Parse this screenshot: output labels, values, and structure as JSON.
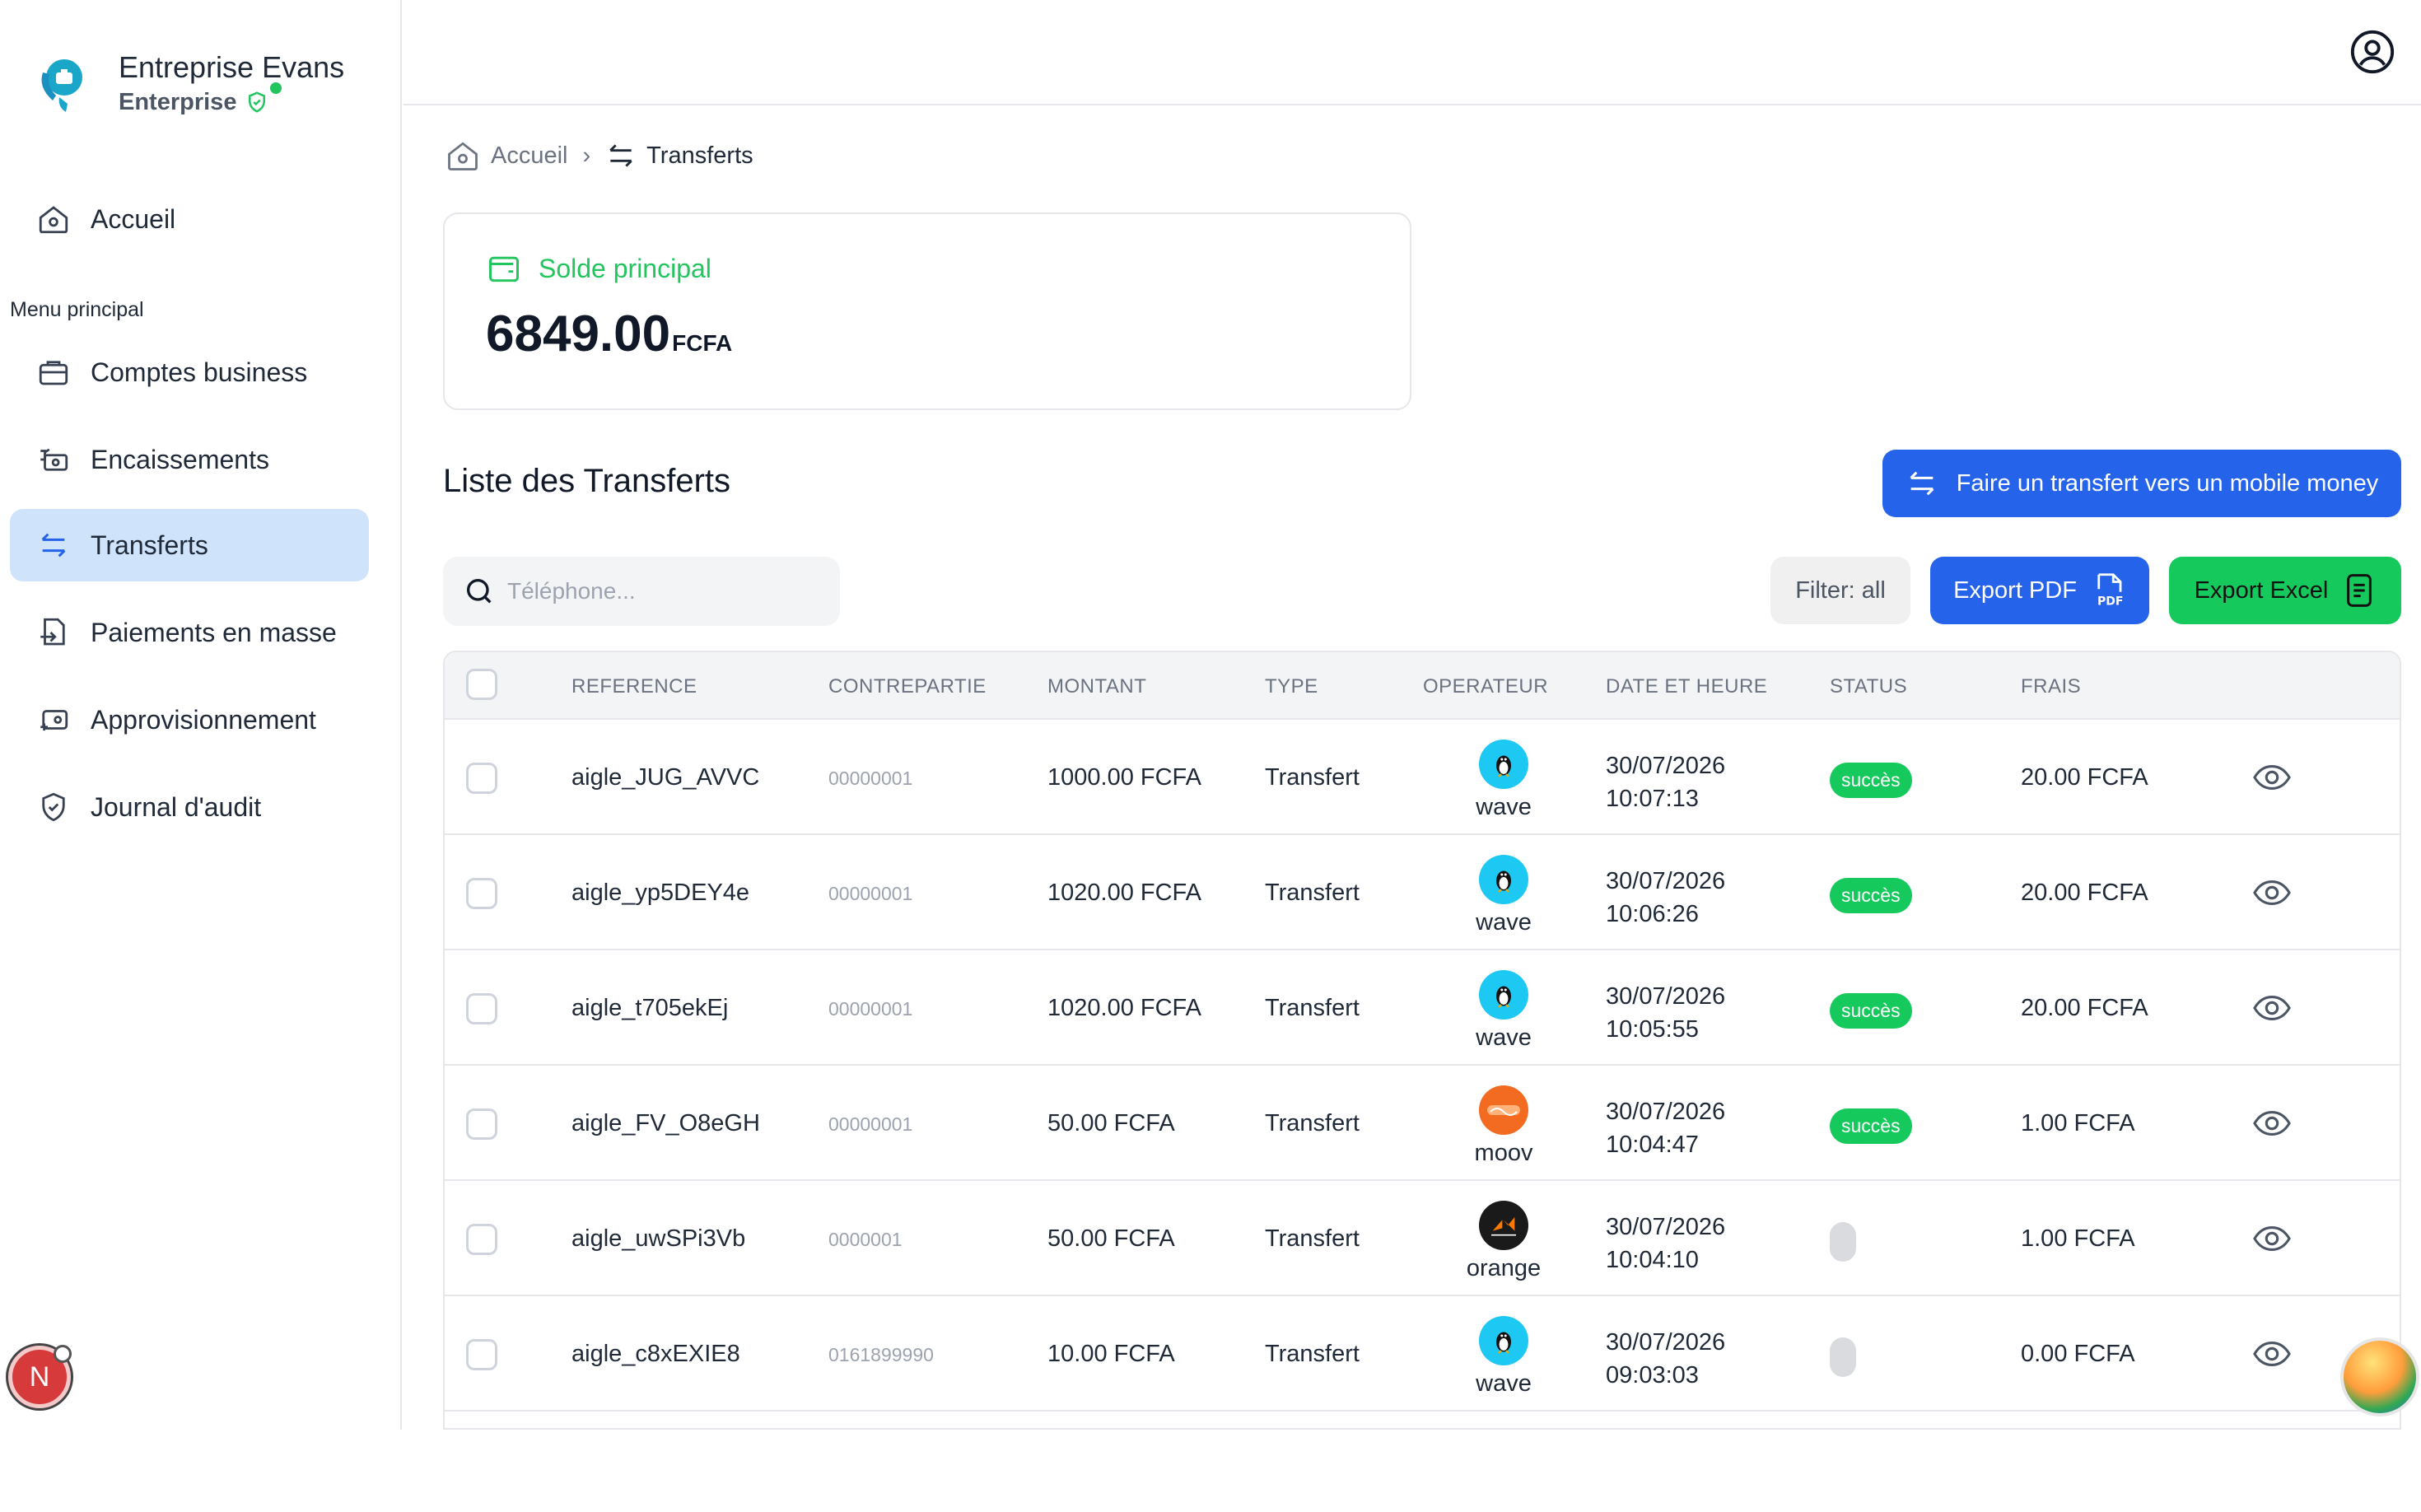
{
  "brand": {
    "name": "Entreprise Evans",
    "plan": "Enterprise"
  },
  "nav": {
    "home": "Accueil",
    "section_label": "Menu principal",
    "items": [
      {
        "label": "Comptes business",
        "icon": "briefcase-icon"
      },
      {
        "label": "Encaissements",
        "icon": "cash-icon"
      },
      {
        "label": "Transferts",
        "icon": "transfer-arrows-icon",
        "active": true
      },
      {
        "label": "Paiements en masse",
        "icon": "bulk-payment-icon"
      },
      {
        "label": "Approvisionnement",
        "icon": "wallet-plus-icon"
      },
      {
        "label": "Journal d'audit",
        "icon": "shield-check-icon"
      }
    ]
  },
  "avatar": {
    "initial": "N"
  },
  "breadcrumb": {
    "home": "Accueil",
    "current": "Transferts"
  },
  "balance": {
    "label": "Solde principal",
    "value": "6849.00",
    "unit": "FCFA"
  },
  "list": {
    "title": "Liste des Transferts",
    "transfer_button": "Faire un transfert vers un mobile money",
    "search_placeholder": "Téléphone...",
    "filter_label": "Filter: all",
    "export_pdf": "Export PDF",
    "export_excel": "Export Excel"
  },
  "table": {
    "columns": [
      "REFERENCE",
      "CONTREPARTIE",
      "MONTANT",
      "TYPE",
      "OPERATEUR",
      "DATE ET HEURE",
      "STATUS",
      "FRAIS"
    ],
    "rows": [
      {
        "reference": "aigle_JUG_AVVC",
        "counterpart": "00000001",
        "amount": "1000.00 FCFA",
        "type": "Transfert",
        "operator": "wave",
        "date": "30/07/2026",
        "time": "10:07:13",
        "status": "succès",
        "fee": "20.00 FCFA"
      },
      {
        "reference": "aigle_yp5DEY4e",
        "counterpart": "00000001",
        "amount": "1020.00 FCFA",
        "type": "Transfert",
        "operator": "wave",
        "date": "30/07/2026",
        "time": "10:06:26",
        "status": "succès",
        "fee": "20.00 FCFA"
      },
      {
        "reference": "aigle_t705ekEj",
        "counterpart": "00000001",
        "amount": "1020.00 FCFA",
        "type": "Transfert",
        "operator": "wave",
        "date": "30/07/2026",
        "time": "10:05:55",
        "status": "succès",
        "fee": "20.00 FCFA"
      },
      {
        "reference": "aigle_FV_O8eGH",
        "counterpart": "00000001",
        "amount": "50.00 FCFA",
        "type": "Transfert",
        "operator": "moov",
        "date": "30/07/2026",
        "time": "10:04:47",
        "status": "succès",
        "fee": "1.00 FCFA"
      },
      {
        "reference": "aigle_uwSPi3Vb",
        "counterpart": "0000001",
        "amount": "50.00 FCFA",
        "type": "Transfert",
        "operator": "orange",
        "date": "30/07/2026",
        "time": "10:04:10",
        "status": "",
        "fee": "1.00 FCFA"
      },
      {
        "reference": "aigle_c8xEXIE8",
        "counterpart": "0161899990",
        "amount": "10.00 FCFA",
        "type": "Transfert",
        "operator": "wave",
        "date": "30/07/2026",
        "time": "09:03:03",
        "status": "",
        "fee": "0.00 FCFA"
      }
    ]
  },
  "colors": {
    "accent_blue": "#2563eb",
    "success_green": "#16c95d",
    "active_nav": "#cfe3fb",
    "wave": "#1dc8f2",
    "moov": "#f26b21",
    "orange": "#1a1a1a"
  }
}
